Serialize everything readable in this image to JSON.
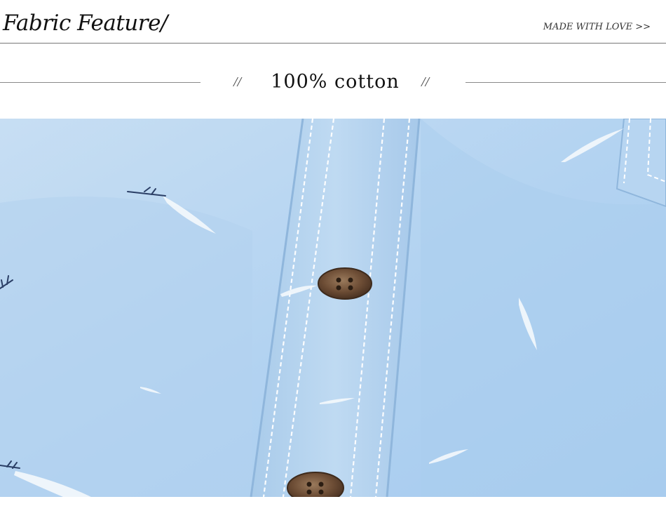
{
  "header": {
    "title": "Fabric Feature/",
    "tagline": "MADE WITH LOVE >>"
  },
  "divider": {
    "left_mark": "//",
    "label": "100% cotton",
    "right_mark": "//"
  },
  "photo": {
    "subject": "light-blue-cotton-shirt-placket-with-buttons"
  },
  "colors": {
    "fabric": "#b8d6f2",
    "button": "#6b4a32",
    "rule": "#777777"
  }
}
